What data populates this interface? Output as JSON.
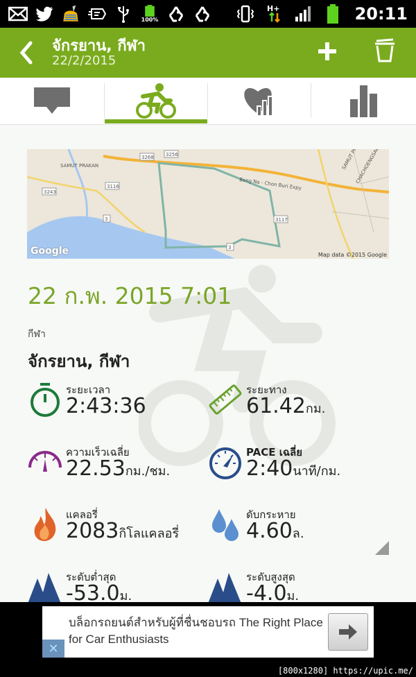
{
  "status_bar": {
    "time": "20:11",
    "battery_left": "100%",
    "icons_left": [
      "mail-icon",
      "twitter-icon",
      "cleaner-icon",
      "handcent-icon",
      "usb-icon",
      "battery-icon",
      "recycle-icon",
      "recycle-icon"
    ],
    "icons_right": [
      "vibrate-icon",
      "hplus-data-icon",
      "signal-icon",
      "battery-icon"
    ]
  },
  "app_bar": {
    "title": "จักรยาน, กีฬา",
    "subtitle": "22/2/2015",
    "color": "#7aab1e"
  },
  "tabs": [
    {
      "name": "comments",
      "icon": "comment-icon"
    },
    {
      "name": "workout",
      "icon": "bike-icon",
      "selected": true
    },
    {
      "name": "heart-rate",
      "icon": "heart-chart-icon"
    },
    {
      "name": "statistics",
      "icon": "bar-chart-icon"
    }
  ],
  "map": {
    "labels": [
      "SAMUT PRAKAN",
      "3268",
      "3256",
      "3116",
      "3243",
      "3",
      "Bang Na - Chon Buri Expy",
      "3117",
      "3",
      "SAMUT PRAKAN",
      "CHACHOENGSAO"
    ],
    "google": "Google",
    "credit": "Map data ©2015 Google"
  },
  "workout": {
    "datetime": "22 ก.พ. 2015 7:01",
    "sport_label": "กีฬา",
    "sport_name": "จักรยาน, กีฬา"
  },
  "stats": {
    "duration": {
      "label": "ระยะเวลา",
      "value": "2:43:36",
      "unit": ""
    },
    "distance": {
      "label": "ระยะทาง",
      "value": "61.42",
      "unit": "กม."
    },
    "avg_speed": {
      "label": "ความเร็วเฉลี่ย",
      "value": "22.53",
      "unit": "กม./ชม."
    },
    "avg_pace": {
      "label": "PACE เฉลี่ย",
      "value": "2:40",
      "unit": "นาที/กม."
    },
    "calories": {
      "label": "แคลอรี่",
      "value": "2083",
      "unit": "กิโลแคลอรี่"
    },
    "hydration": {
      "label": "ดับกระหาย",
      "value": "4.60",
      "unit": "ล."
    },
    "min_alt": {
      "label": "ระดับต่ำสุด",
      "value": "-53.0",
      "unit": "ม."
    },
    "max_alt": {
      "label": "ระดับสูงสุด",
      "value": "-4.0",
      "unit": "ม."
    }
  },
  "ad": {
    "text": "บล็อกรถยนต์สำหรับผู้ที่ชื่นชอบรถ The Right Place for Car Enthusiasts",
    "close_symbol": "✕"
  },
  "watermark": "[800x1280] https://upic.me/"
}
